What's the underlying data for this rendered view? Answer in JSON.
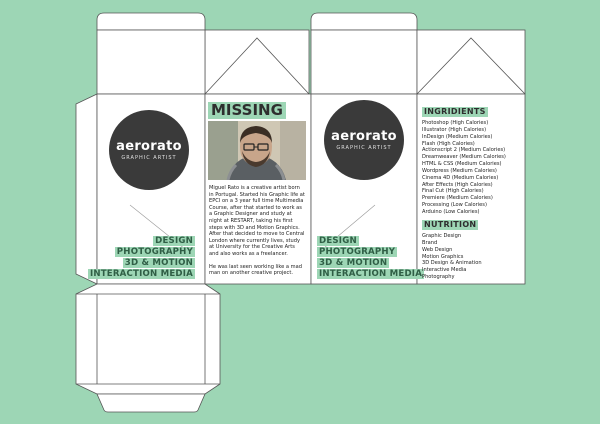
{
  "colors": {
    "background": "#9dd6b5",
    "panel": "#ffffff",
    "outline": "#555555",
    "logo_circle": "#3a3a3a",
    "highlight": "#9dd6b5"
  },
  "logo": {
    "word": "aerorato",
    "subtitle": "GRAPHIC ARTIST"
  },
  "tags": [
    "DESIGN",
    "PHOTOGRAPHY",
    "3D & MOTION",
    "INTERACTION MEDIA"
  ],
  "missing": {
    "title": "MISSING",
    "photo_icon": "portrait-photo",
    "bio": [
      "Miguel Rato is a creative artist born in Portugal. Started his Graphic life at EPCI on a 3 year full time Multimedia Course, after that started to work as a Graphic Designer and study at night at RESTART, taking his first steps with 3D and Motion Graphics. After that decided to move to Central London where currently lives, study at University for the Creative Arts and also works as a freelancer.",
      "He was last seen working like a mad man on another creative project."
    ]
  },
  "ingredients": {
    "title": "INGRIDIENTS",
    "items": [
      "Photoshop (High Calories)",
      "Illustrator (High Calories)",
      "InDesign (Medium Calories)",
      "Flash (High Calories)",
      "Actionscript 2 (Medium Calories)",
      "Dreamweaver (Medium Calories)",
      "HTML & CSS (Medium Calories)",
      "Wordpress (Medium Calories)",
      "Cinema 4D (Medium Calories)",
      "After Effects (High Calories)",
      "Final Cut (High Calories)",
      "Premiere (Medium Calories)",
      "Processing (Low Calories)",
      "Arduino (Low Calories)"
    ]
  },
  "nutrition": {
    "title": "NUTRITION",
    "items": [
      "Graphic Design",
      "Brand",
      "Web Design",
      "Motion Graphics",
      "3D Design & Animation",
      "Interactive Media",
      "Photography"
    ]
  }
}
